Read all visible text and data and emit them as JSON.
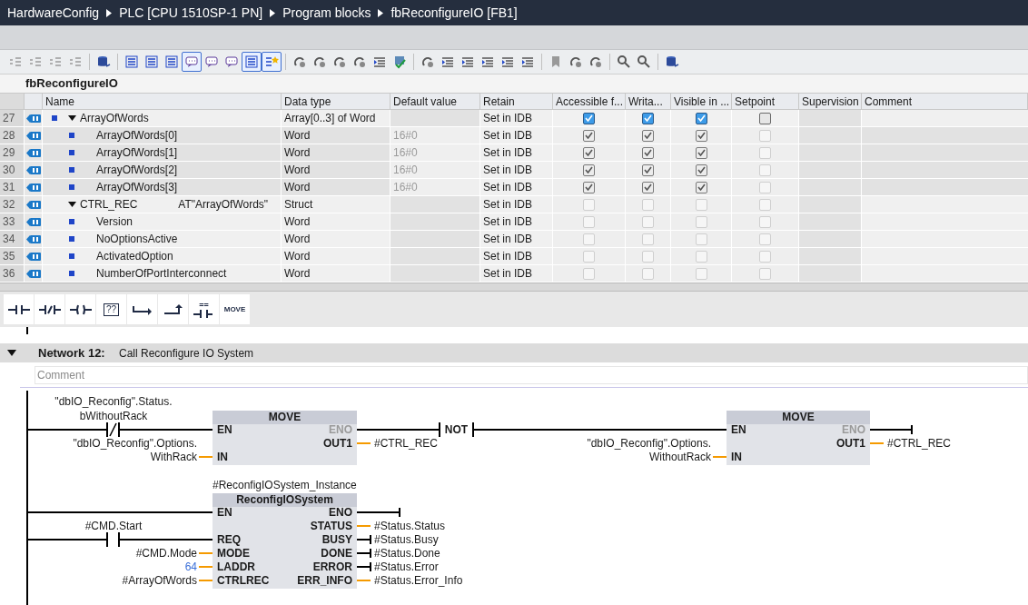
{
  "breadcrumb": [
    "HardwareConfig",
    "PLC [CPU 1510SP-1 PN]",
    "Program blocks",
    "fbReconfigureIO [FB1]"
  ],
  "toolbar": [
    {
      "buttons": [
        {
          "selected": false
        },
        {
          "selected": false
        },
        {
          "selected": false
        },
        {
          "selected": false
        }
      ]
    },
    {
      "buttons": [
        {
          "selected": false
        }
      ]
    },
    {
      "buttons": [
        {
          "selected": false
        },
        {
          "selected": false
        },
        {
          "selected": false
        },
        {
          "selected": true
        },
        {
          "selected": false
        },
        {
          "selected": false
        },
        {
          "selected": true
        },
        {
          "selected": true
        }
      ]
    },
    {
      "buttons": [
        {
          "selected": false
        },
        {
          "selected": false
        },
        {
          "selected": false
        },
        {
          "selected": false
        },
        {
          "selected": false
        },
        {
          "selected": false
        }
      ]
    },
    {
      "buttons": [
        {
          "selected": false
        },
        {
          "selected": false
        },
        {
          "selected": false
        },
        {
          "selected": false
        },
        {
          "selected": false
        },
        {
          "selected": false
        }
      ]
    },
    {
      "buttons": [
        {
          "selected": false
        },
        {
          "selected": false
        },
        {
          "selected": false
        }
      ]
    },
    {
      "buttons": [
        {
          "selected": false
        },
        {
          "selected": false
        }
      ]
    },
    {
      "buttons": [
        {
          "selected": false
        }
      ]
    }
  ],
  "block_title": "fbReconfigureIO",
  "columns": [
    "Name",
    "Data type",
    "Default value",
    "Retain",
    "Accessible f...",
    "Writa...",
    "Visible in ...",
    "Setpoint",
    "Supervision",
    "Comment"
  ],
  "variables": [
    {
      "number": "27",
      "name": "ArrayOfWords",
      "data_type": "Array[0..3] of Word",
      "retain": "Set in IDB",
      "bullet": true,
      "expanded": true,
      "editable": true,
      "checks_enabled": true,
      "accessible": true,
      "writable": true,
      "visible": true,
      "setpoint": false,
      "children": [
        {
          "number": "28",
          "name": "ArrayOfWords[0]",
          "data_type": "Word",
          "default_value": "16#0",
          "retain": "Set in IDB",
          "bullet": true,
          "editable": false,
          "checks_enabled": false,
          "accessible": true,
          "writable": true,
          "visible": true,
          "setpoint": false
        },
        {
          "number": "29",
          "name": "ArrayOfWords[1]",
          "data_type": "Word",
          "default_value": "16#0",
          "retain": "Set in IDB",
          "bullet": true,
          "editable": false,
          "checks_enabled": false,
          "accessible": true,
          "writable": true,
          "visible": true,
          "setpoint": false
        },
        {
          "number": "30",
          "name": "ArrayOfWords[2]",
          "data_type": "Word",
          "default_value": "16#0",
          "retain": "Set in IDB",
          "bullet": true,
          "editable": false,
          "checks_enabled": false,
          "accessible": true,
          "writable": true,
          "visible": true,
          "setpoint": false
        },
        {
          "number": "31",
          "name": "ArrayOfWords[3]",
          "data_type": "Word",
          "default_value": "16#0",
          "retain": "Set in IDB",
          "bullet": true,
          "editable": false,
          "checks_enabled": false,
          "accessible": true,
          "writable": true,
          "visible": true,
          "setpoint": false
        }
      ]
    },
    {
      "number": "32",
      "name": "CTRL_REC",
      "overlay": "AT\"ArrayOfWords\"",
      "data_type": "Struct",
      "retain": "Set in IDB",
      "bullet": false,
      "expanded": true,
      "editable": true,
      "checks_enabled": false,
      "accessible": false,
      "writable": false,
      "visible": false,
      "setpoint": false,
      "children": [
        {
          "number": "33",
          "name": "Version",
          "data_type": "Word",
          "retain": "Set in IDB",
          "bullet": true,
          "editable": true,
          "checks_enabled": false,
          "accessible": false,
          "writable": false,
          "visible": false,
          "setpoint": false
        },
        {
          "number": "34",
          "name": "NoOptionsActive",
          "data_type": "Word",
          "retain": "Set in IDB",
          "bullet": true,
          "editable": true,
          "checks_enabled": false,
          "accessible": false,
          "writable": false,
          "visible": false,
          "setpoint": false
        },
        {
          "number": "35",
          "name": "ActivatedOption",
          "data_type": "Word",
          "retain": "Set in IDB",
          "bullet": true,
          "editable": true,
          "checks_enabled": false,
          "accessible": false,
          "writable": false,
          "visible": false,
          "setpoint": false
        },
        {
          "number": "36",
          "name": "NumberOfPortInterconnect",
          "data_type": "Word",
          "retain": "Set in IDB",
          "bullet": true,
          "editable": true,
          "checks_enabled": false,
          "accessible": false,
          "writable": false,
          "visible": false,
          "setpoint": false
        }
      ]
    }
  ],
  "palette": [
    {
      "kind": "contact"
    },
    {
      "kind": "negated_contact"
    },
    {
      "kind": "coil"
    },
    {
      "kind": "box",
      "label": "??"
    },
    {
      "kind": "branch_open"
    },
    {
      "kind": "branch_close"
    },
    {
      "kind": "compare",
      "label": "=="
    },
    {
      "kind": "text",
      "label": "MOVE"
    }
  ],
  "network": {
    "expanded": true,
    "number_label": "Network 12:",
    "title": "Call Reconfigure IO System",
    "comment_placeholder": "Comment"
  },
  "ladder": {
    "contacts": [
      {
        "operand_lines": [
          "\"dbIO_Reconfig\".Status.",
          "bWithoutRack"
        ],
        "negated": true
      },
      {
        "operand_lines": [
          "#CMD.Start"
        ],
        "negated": false
      }
    ],
    "not_contact": {
      "label": "NOT"
    },
    "boxes": [
      {
        "title": "MOVE",
        "inputs": [
          {
            "pin": "EN"
          },
          {
            "pin": "IN",
            "operand_lines": [
              "\"dbIO_Reconfig\".Options.",
              "WithRack"
            ],
            "kind": "data"
          }
        ],
        "outputs": [
          {
            "pin": "ENO",
            "active": false,
            "kind": "bool"
          },
          {
            "pin": "OUT1",
            "operand": "#CTRL_REC",
            "kind": "data"
          }
        ]
      },
      {
        "title": "MOVE",
        "inputs": [
          {
            "pin": "EN"
          },
          {
            "pin": "IN",
            "operand_lines": [
              "\"dbIO_Reconfig\".Options.",
              "WithoutRack"
            ],
            "kind": "data"
          }
        ],
        "outputs": [
          {
            "pin": "ENO",
            "active": false,
            "kind": "bool"
          },
          {
            "pin": "OUT1",
            "operand": "#CTRL_REC",
            "kind": "data"
          }
        ]
      },
      {
        "instance": "#ReconfigIOSystem_Instance",
        "title": "ReconfigIOSystem",
        "inputs": [
          {
            "pin": "EN"
          },
          {
            "pin": "REQ"
          },
          {
            "pin": "MODE",
            "operand_lines": [
              "#CMD.Mode"
            ],
            "kind": "data"
          },
          {
            "pin": "LADDR",
            "operand_lines": [
              "64"
            ],
            "kind": "constant"
          },
          {
            "pin": "CTRLREC",
            "operand_lines": [
              "#ArrayOfWords"
            ],
            "kind": "data"
          }
        ],
        "outputs": [
          {
            "pin": "ENO",
            "active": true,
            "kind": "bool"
          },
          {
            "pin": "STATUS",
            "operand": "#Status.Status",
            "kind": "data"
          },
          {
            "pin": "BUSY",
            "operand": "#Status.Busy",
            "kind": "bool"
          },
          {
            "pin": "DONE",
            "operand": "#Status.Done",
            "kind": "bool"
          },
          {
            "pin": "ERROR",
            "operand": "#Status.Error",
            "kind": "bool"
          },
          {
            "pin": "ERR_INFO",
            "operand": "#Status.Error_Info",
            "kind": "data"
          }
        ]
      }
    ]
  }
}
